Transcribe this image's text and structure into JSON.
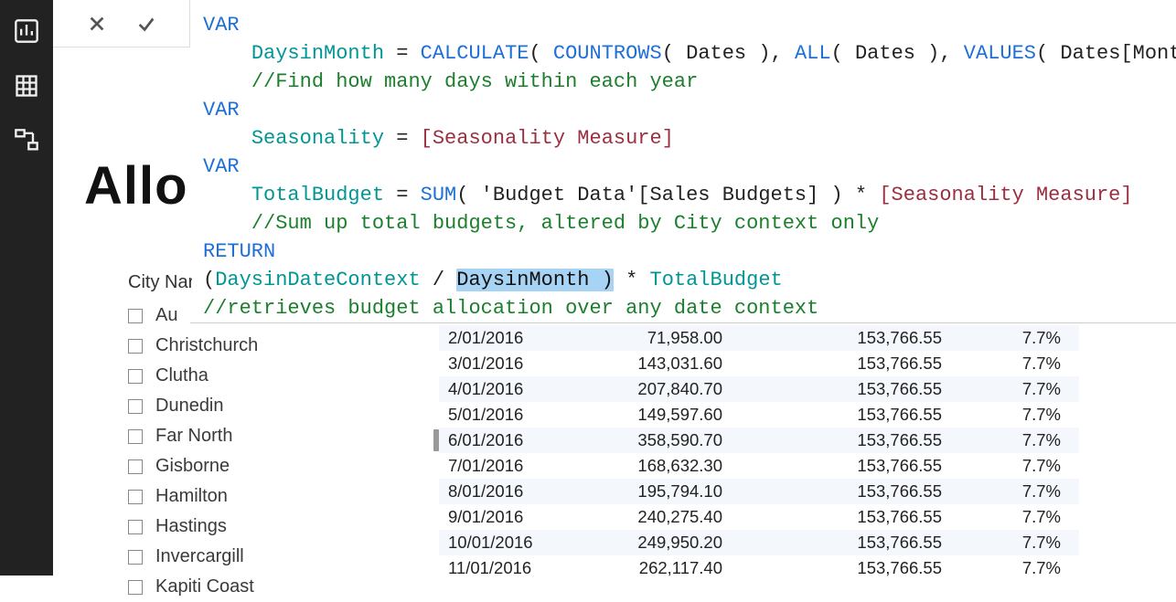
{
  "page_title_fragment": "Allo",
  "slicer_label_fragment": "City Nar",
  "slicer_items": [
    "Au",
    "Christchurch",
    "Clutha",
    "Dunedin",
    "Far North",
    "Gisborne",
    "Hamilton",
    "Hastings",
    "Invercargill",
    "Kapiti Coast"
  ],
  "formula": {
    "lines": [
      {
        "type": "kw",
        "indent": 0,
        "tokens": [
          [
            "kw",
            "VAR"
          ]
        ]
      },
      {
        "type": "mix",
        "indent": 1,
        "tokens": [
          [
            "id",
            "DaysinMonth"
          ],
          [
            "txt",
            " = "
          ],
          [
            "fn",
            "CALCULATE"
          ],
          [
            "txt",
            "( "
          ],
          [
            "fn",
            "COUNTROWS"
          ],
          [
            "txt",
            "( Dates ), "
          ],
          [
            "fn",
            "ALL"
          ],
          [
            "txt",
            "( Dates ), "
          ],
          [
            "fn",
            "VALUES"
          ],
          [
            "txt",
            "( Dates[Month & Year] ) )"
          ]
        ]
      },
      {
        "type": "cmt",
        "indent": 1,
        "tokens": [
          [
            "cmt",
            "//Find how many days within each year"
          ]
        ]
      },
      {
        "type": "kw",
        "indent": 0,
        "tokens": [
          [
            "kw",
            "VAR"
          ]
        ]
      },
      {
        "type": "mix",
        "indent": 1,
        "tokens": [
          [
            "id",
            "Seasonality"
          ],
          [
            "txt",
            " = "
          ],
          [
            "ref",
            "[Seasonality Measure]"
          ]
        ]
      },
      {
        "type": "kw",
        "indent": 0,
        "tokens": [
          [
            "kw",
            "VAR"
          ]
        ]
      },
      {
        "type": "mix",
        "indent": 1,
        "tokens": [
          [
            "id",
            "TotalBudget"
          ],
          [
            "txt",
            " = "
          ],
          [
            "fn",
            "SUM"
          ],
          [
            "txt",
            "( 'Budget Data'[Sales Budgets] ) * "
          ],
          [
            "ref",
            "[Seasonality Measure]"
          ]
        ]
      },
      {
        "type": "cmt",
        "indent": 1,
        "tokens": [
          [
            "cmt",
            "//Sum up total budgets, altered by City context only"
          ]
        ]
      },
      {
        "type": "kw",
        "indent": 0,
        "tokens": [
          [
            "kw",
            "RETURN"
          ]
        ]
      },
      {
        "type": "mix",
        "indent": 0,
        "tokens": [
          [
            "txt",
            "("
          ],
          [
            "id",
            "DaysinDateContext"
          ],
          [
            "txt",
            " / "
          ],
          [
            "sel",
            "DaysinMonth )"
          ],
          [
            "txt",
            " * "
          ],
          [
            "id",
            "TotalBudget"
          ]
        ]
      },
      {
        "type": "cmt",
        "indent": 0,
        "tokens": [
          [
            "cmt",
            "//retrieves budget allocation over any date context"
          ]
        ]
      }
    ],
    "indent_str": "    "
  },
  "table_rows": [
    {
      "date": "2/01/2016",
      "v1": "71,958.00",
      "v2": "153,766.55",
      "v3": "7.7%"
    },
    {
      "date": "3/01/2016",
      "v1": "143,031.60",
      "v2": "153,766.55",
      "v3": "7.7%"
    },
    {
      "date": "4/01/2016",
      "v1": "207,840.70",
      "v2": "153,766.55",
      "v3": "7.7%"
    },
    {
      "date": "5/01/2016",
      "v1": "149,597.60",
      "v2": "153,766.55",
      "v3": "7.7%"
    },
    {
      "date": "6/01/2016",
      "v1": "358,590.70",
      "v2": "153,766.55",
      "v3": "7.7%"
    },
    {
      "date": "7/01/2016",
      "v1": "168,632.30",
      "v2": "153,766.55",
      "v3": "7.7%"
    },
    {
      "date": "8/01/2016",
      "v1": "195,794.10",
      "v2": "153,766.55",
      "v3": "7.7%"
    },
    {
      "date": "9/01/2016",
      "v1": "240,275.40",
      "v2": "153,766.55",
      "v3": "7.7%"
    },
    {
      "date": "10/01/2016",
      "v1": "249,950.20",
      "v2": "153,766.55",
      "v3": "7.7%"
    },
    {
      "date": "11/01/2016",
      "v1": "262,117.40",
      "v2": "153,766.55",
      "v3": "7.7%"
    }
  ]
}
